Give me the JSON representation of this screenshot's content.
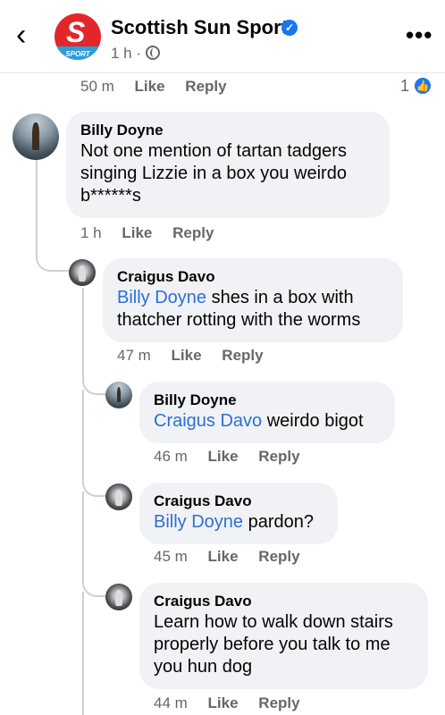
{
  "header": {
    "back_icon": "chevron-left-icon",
    "page_name": "Scottish Sun Sport",
    "post_time": "1 h ·",
    "avatar_glyph": "S",
    "avatar_caption": "SPORT",
    "verified_glyph": "✓",
    "more_glyph": "•••",
    "brand_color": "#e4262b"
  },
  "parent_comment_actions": {
    "time": "50 m",
    "like": "Like",
    "reply": "Reply",
    "reaction_count": "1",
    "reaction_icon": "like-icon"
  },
  "comments": [
    {
      "author": "Billy Doyne",
      "text": "Not one mention of tartan tadgers singing Lizzie in a box you weirdo b******s",
      "time": "1 h",
      "like": "Like",
      "reply": "Reply"
    },
    {
      "author": "Craigus Davo",
      "mention": "Billy Doyne",
      "text": " shes in a box with thatcher rotting with the worms",
      "time": "47 m",
      "like": "Like",
      "reply": "Reply"
    },
    {
      "author": "Billy Doyne",
      "mention": "Craigus Davo",
      "text": " weirdo bigot",
      "time": "46 m",
      "like": "Like",
      "reply": "Reply"
    },
    {
      "author": "Craigus Davo",
      "mention": "Billy Doyne",
      "text": " pardon?",
      "time": "45 m",
      "like": "Like",
      "reply": "Reply"
    },
    {
      "author": "Craigus Davo",
      "text": "Learn how to walk down stairs properly before you talk to me you hun dog",
      "time": "44 m",
      "like": "Like",
      "reply": "Reply"
    }
  ]
}
